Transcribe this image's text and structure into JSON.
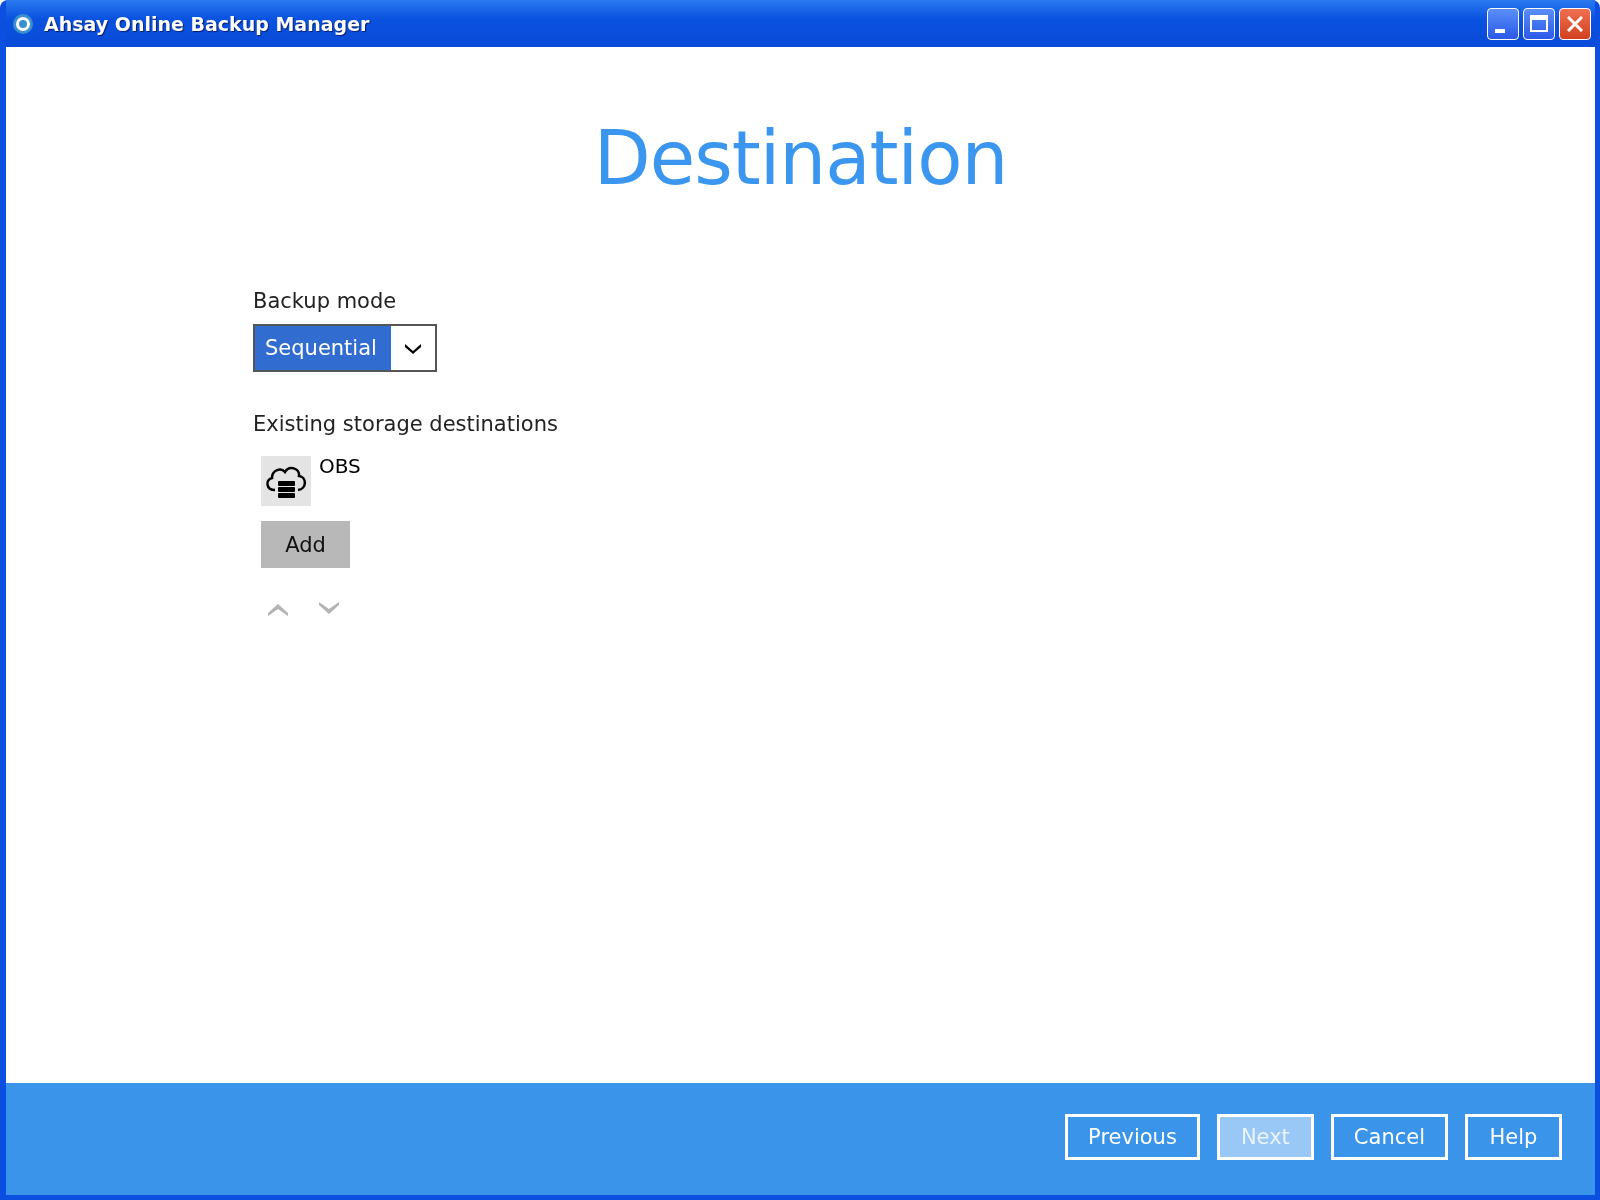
{
  "window": {
    "title": "Ahsay Online Backup Manager"
  },
  "heading": "Destination",
  "backup_mode": {
    "label": "Backup mode",
    "value": "Sequential"
  },
  "destinations": {
    "label": "Existing storage destinations",
    "items": [
      {
        "name": "OBS"
      }
    ],
    "add_button": "Add",
    "move_up_disabled": true,
    "move_down_disabled": true
  },
  "footer_buttons": [
    {
      "label": "Previous",
      "disabled": false
    },
    {
      "label": "Next",
      "disabled": true
    },
    {
      "label": "Cancel",
      "disabled": false
    },
    {
      "label": "Help",
      "disabled": false
    }
  ]
}
